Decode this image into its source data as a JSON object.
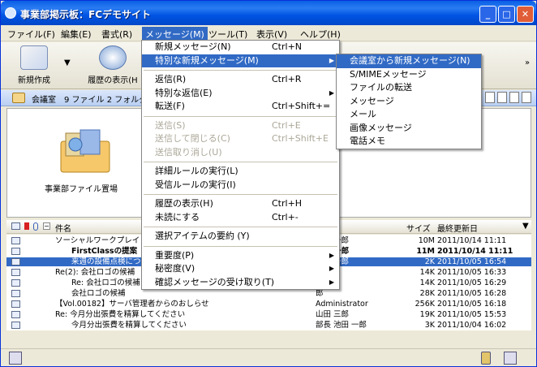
{
  "window": {
    "title": "事業部掲示板：FCデモサイト",
    "controls": {
      "minimize": "_",
      "maximize": "□",
      "close": "✕"
    }
  },
  "menubar": [
    "ファイル(F)",
    "編集(E)",
    "書式(R)",
    "メッセージ(M)",
    "ツール(T)",
    "表示(V)",
    "ヘルプ(H)"
  ],
  "toolbar": {
    "buttons": [
      "新規作成",
      "履歴の表示(H"
    ]
  },
  "pathbar": {
    "text": "会議室　9 ファイル 2 フォルダ"
  },
  "panel": {
    "folder_label": "事業部ファイル置場"
  },
  "list": {
    "columns": {
      "name": "件名",
      "size": "サイズ",
      "modified": "最終更新日"
    },
    "rows": [
      {
        "subject": "ソーシャルワークプレイ",
        "author": "池田 一郎",
        "size": "10M",
        "date": "2011/10/14 11:11",
        "bold": false,
        "selected": false
      },
      {
        "subject": "FirstClassの提案",
        "author": "池田 一郎",
        "size": "11M",
        "date": "2011/10/14 11:11",
        "bold": true,
        "selected": false
      },
      {
        "subject": "来週の設備点検につい",
        "author": "池田 一郎",
        "size": "2K",
        "date": "2011/10/05 16:54",
        "bold": false,
        "selected": true
      },
      {
        "subject": "Re(2): 会社ロゴの候補",
        "author": "一郎",
        "size": "14K",
        "date": "2011/10/05 16:33",
        "bold": false,
        "selected": false
      },
      {
        "subject": "Re: 会社ロゴの候補",
        "author": "郎",
        "size": "14K",
        "date": "2011/10/05 16:29",
        "bold": false,
        "selected": false
      },
      {
        "subject": "会社ロゴの候補",
        "author": "郎",
        "size": "28K",
        "date": "2011/10/05 16:28",
        "bold": false,
        "selected": false
      },
      {
        "subject": "【Vol.00182】サーバ管理者からのおしらせ",
        "author": "Administrator",
        "size": "256K",
        "date": "2011/10/05 16:18",
        "bold": false,
        "selected": false
      },
      {
        "subject": "Re: 今月分出張費を精算してください",
        "author": "山田 三郎",
        "size": "19K",
        "date": "2011/10/05 15:53",
        "bold": false,
        "selected": false
      },
      {
        "subject": "今月分出張費を精算してください",
        "author": "部長 池田 一郎",
        "size": "3K",
        "date": "2011/10/04 16:02",
        "bold": false,
        "selected": false
      }
    ]
  },
  "message_menu": {
    "items": [
      {
        "label": "新規メッセージ(N)",
        "shortcut": "Ctrl+N"
      },
      {
        "label": "特別な新規メッセージ(M)",
        "submenu": true,
        "highlighted": true
      },
      {
        "sep": true
      },
      {
        "label": "返信(R)",
        "shortcut": "Ctrl+R"
      },
      {
        "label": "特別な返信(E)",
        "submenu": true
      },
      {
        "label": "転送(F)",
        "shortcut": "Ctrl+Shift+="
      },
      {
        "sep": true
      },
      {
        "label": "送信(S)",
        "shortcut": "Ctrl+E",
        "disabled": true
      },
      {
        "label": "送信して閉じる(C)",
        "shortcut": "Ctrl+Shift+E",
        "disabled": true
      },
      {
        "label": "送信取り消し(U)",
        "disabled": true
      },
      {
        "sep": true
      },
      {
        "label": "詳細ルールの実行(L)"
      },
      {
        "label": "受信ルールの実行(I)"
      },
      {
        "sep": true
      },
      {
        "label": "履歴の表示(H)",
        "shortcut": "Ctrl+H"
      },
      {
        "label": "未読にする",
        "shortcut": "Ctrl+-"
      },
      {
        "sep": true
      },
      {
        "label": "選択アイテムの要約 (Y)"
      },
      {
        "sep": true
      },
      {
        "label": "重要度(P)",
        "submenu": true
      },
      {
        "label": "秘密度(V)",
        "submenu": true
      },
      {
        "label": "確認メッセージの受け取り(T)",
        "submenu": true
      }
    ]
  },
  "special_submenu": {
    "items": [
      {
        "label": "会議室から新規メッセージ(N)",
        "highlighted": true
      },
      {
        "label": "S/MIMEメッセージ"
      },
      {
        "label": "ファイルの転送"
      },
      {
        "label": "メッセージ"
      },
      {
        "label": "メール"
      },
      {
        "label": "画像メッセージ"
      },
      {
        "label": "電話メモ"
      }
    ]
  },
  "colors": {
    "highlight": "#316ac5",
    "titlebar": "#0054e3"
  }
}
